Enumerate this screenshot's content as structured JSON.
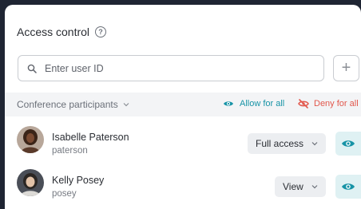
{
  "panel": {
    "title": "Access control",
    "help_icon": "help-circle-icon"
  },
  "search": {
    "placeholder": "Enter user ID",
    "value": "",
    "icon": "search-icon",
    "add_icon": "plus-icon"
  },
  "toolbar": {
    "group_label": "Conference participants",
    "allow_all_label": "Allow for all",
    "deny_all_label": "Deny for all"
  },
  "participants": [
    {
      "name": "Isabelle Paterson",
      "username": "paterson",
      "access": "Full access"
    },
    {
      "name": "Kelly Posey",
      "username": "posey",
      "access": "View"
    }
  ],
  "colors": {
    "background": "#1f2533",
    "allow": "#1793a6",
    "deny": "#e2574c",
    "eye_button_bg": "#dff1f3"
  }
}
